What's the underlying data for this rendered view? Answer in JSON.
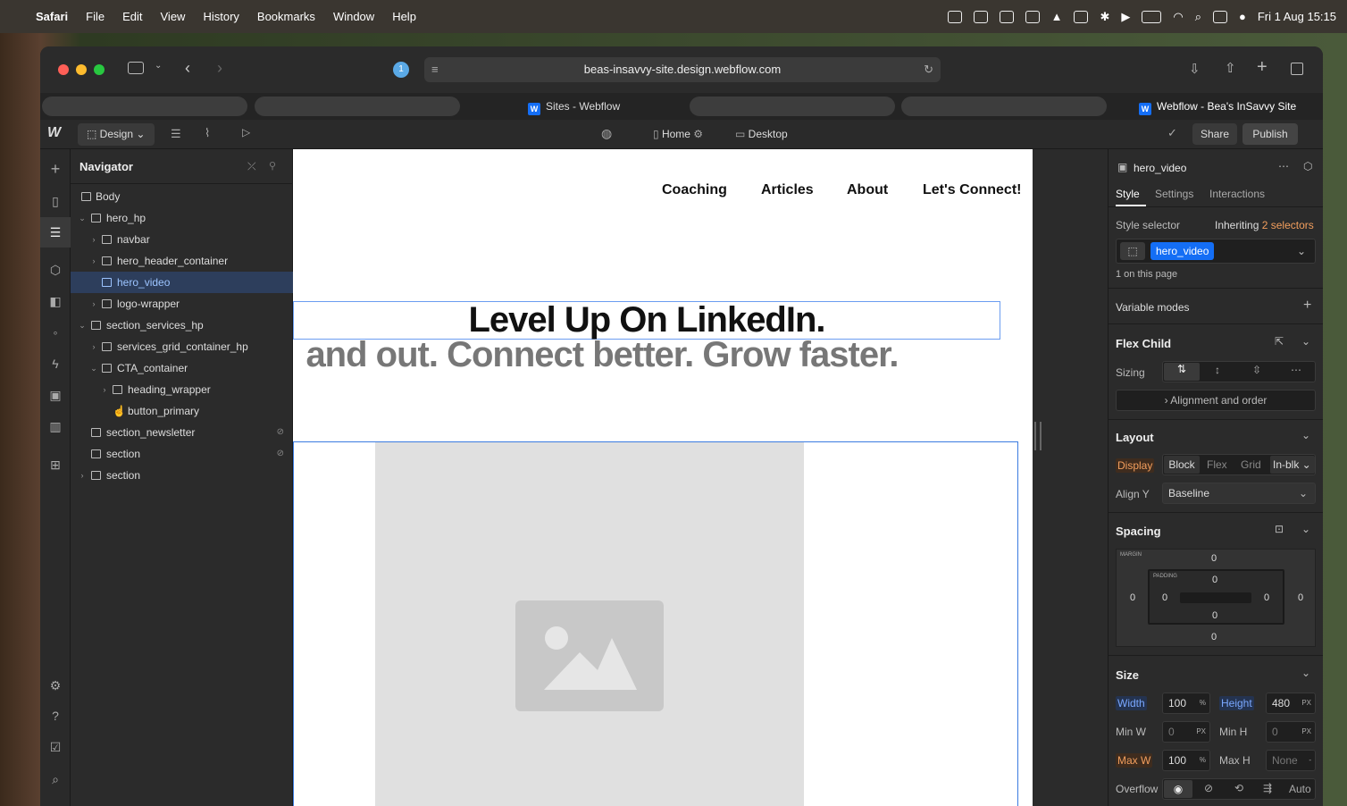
{
  "menubar": {
    "app": "Safari",
    "items": [
      "File",
      "Edit",
      "View",
      "History",
      "Bookmarks",
      "Window",
      "Help"
    ],
    "datetime": "Fri 1 Aug  15:15"
  },
  "browser": {
    "url": "beas-insavvy-site.design.webflow.com",
    "tab_count_badge": "1",
    "tabs": [
      "Sites - Webflow",
      "Webflow - Bea's InSavvy Site"
    ]
  },
  "toolbar": {
    "design_label": "Design",
    "page_label": "Home",
    "breakpoint_label": "Desktop",
    "share_label": "Share",
    "publish_label": "Publish"
  },
  "navigator": {
    "title": "Navigator",
    "items": [
      {
        "label": "Body"
      },
      {
        "label": "hero_hp"
      },
      {
        "label": "navbar"
      },
      {
        "label": "hero_header_container"
      },
      {
        "label": "hero_video"
      },
      {
        "label": "logo-wrapper"
      },
      {
        "label": "section_services_hp"
      },
      {
        "label": "services_grid_container_hp"
      },
      {
        "label": "CTA_container"
      },
      {
        "label": "heading_wrapper"
      },
      {
        "label": "button_primary"
      },
      {
        "label": "section_newsletter"
      },
      {
        "label": "section"
      },
      {
        "label": "section"
      }
    ]
  },
  "canvas": {
    "nav_links": [
      "Coaching",
      "Articles",
      "About",
      "Let's Connect!"
    ],
    "heading": "Level Up On LinkedIn.",
    "subheading": "and out. Connect better. Grow faster."
  },
  "panel": {
    "element_name": "hero_video",
    "tabs": [
      "Style",
      "Settings",
      "Interactions"
    ],
    "style_selector_label": "Style selector",
    "inheriting_label": "Inheriting",
    "selectors_count": "2 selectors",
    "selector_chip": "hero_video",
    "on_page": "1 on this page",
    "variable_modes": "Variable modes",
    "flex_child_title": "Flex Child",
    "sizing_label": "Sizing",
    "alignment_label": "Alignment and order",
    "layout_title": "Layout",
    "display_label": "Display",
    "display_options": [
      "Block",
      "Flex",
      "Grid",
      "In-blk"
    ],
    "align_y_label": "Align Y",
    "align_y_value": "Baseline",
    "spacing_title": "Spacing",
    "margin_label": "MARGIN",
    "padding_label": "PADDING",
    "margin": {
      "top": "0",
      "right": "0",
      "bottom": "0",
      "left": "0"
    },
    "padding": {
      "top": "0",
      "right": "0",
      "bottom": "0",
      "left": "0"
    },
    "size_title": "Size",
    "width_label": "Width",
    "width_value": "100",
    "width_unit": "%",
    "height_label": "Height",
    "height_value": "480",
    "height_unit": "PX",
    "minw_label": "Min W",
    "minw_value": "0",
    "minw_unit": "PX",
    "minh_label": "Min H",
    "minh_value": "0",
    "minh_unit": "PX",
    "maxw_label": "Max W",
    "maxw_value": "100",
    "maxw_unit": "%",
    "maxh_label": "Max H",
    "maxh_value": "None",
    "overflow_label": "Overflow",
    "overflow_auto": "Auto"
  },
  "colors": {
    "accent": "#146ef5",
    "selection": "#2d3e5c",
    "orange": "#f29e5d"
  }
}
